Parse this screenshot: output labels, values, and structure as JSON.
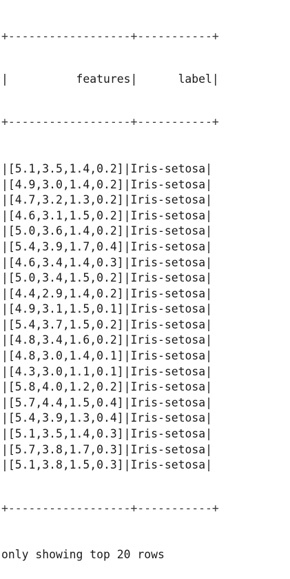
{
  "table": {
    "border_line": "+------------------+-----------+",
    "header_line": "|          features|      label|",
    "columns": [
      "features",
      "label"
    ],
    "rows": [
      {
        "features": "[5.1,3.5,1.4,0.2]",
        "label": "Iris-setosa"
      },
      {
        "features": "[4.9,3.0,1.4,0.2]",
        "label": "Iris-setosa"
      },
      {
        "features": "[4.7,3.2,1.3,0.2]",
        "label": "Iris-setosa"
      },
      {
        "features": "[4.6,3.1,1.5,0.2]",
        "label": "Iris-setosa"
      },
      {
        "features": "[5.0,3.6,1.4,0.2]",
        "label": "Iris-setosa"
      },
      {
        "features": "[5.4,3.9,1.7,0.4]",
        "label": "Iris-setosa"
      },
      {
        "features": "[4.6,3.4,1.4,0.3]",
        "label": "Iris-setosa"
      },
      {
        "features": "[5.0,3.4,1.5,0.2]",
        "label": "Iris-setosa"
      },
      {
        "features": "[4.4,2.9,1.4,0.2]",
        "label": "Iris-setosa"
      },
      {
        "features": "[4.9,3.1,1.5,0.1]",
        "label": "Iris-setosa"
      },
      {
        "features": "[5.4,3.7,1.5,0.2]",
        "label": "Iris-setosa"
      },
      {
        "features": "[4.8,3.4,1.6,0.2]",
        "label": "Iris-setosa"
      },
      {
        "features": "[4.8,3.0,1.4,0.1]",
        "label": "Iris-setosa"
      },
      {
        "features": "[4.3,3.0,1.1,0.1]",
        "label": "Iris-setosa"
      },
      {
        "features": "[5.8,4.0,1.2,0.2]",
        "label": "Iris-setosa"
      },
      {
        "features": "[5.7,4.4,1.5,0.4]",
        "label": "Iris-setosa"
      },
      {
        "features": "[5.4,3.9,1.3,0.4]",
        "label": "Iris-setosa"
      },
      {
        "features": "[5.1,3.5,1.4,0.3]",
        "label": "Iris-setosa"
      },
      {
        "features": "[5.7,3.8,1.7,0.3]",
        "label": "Iris-setosa"
      },
      {
        "features": "[5.1,3.8,1.5,0.3]",
        "label": "Iris-setosa"
      }
    ]
  },
  "footer": {
    "note": "only showing top 20 rows"
  }
}
